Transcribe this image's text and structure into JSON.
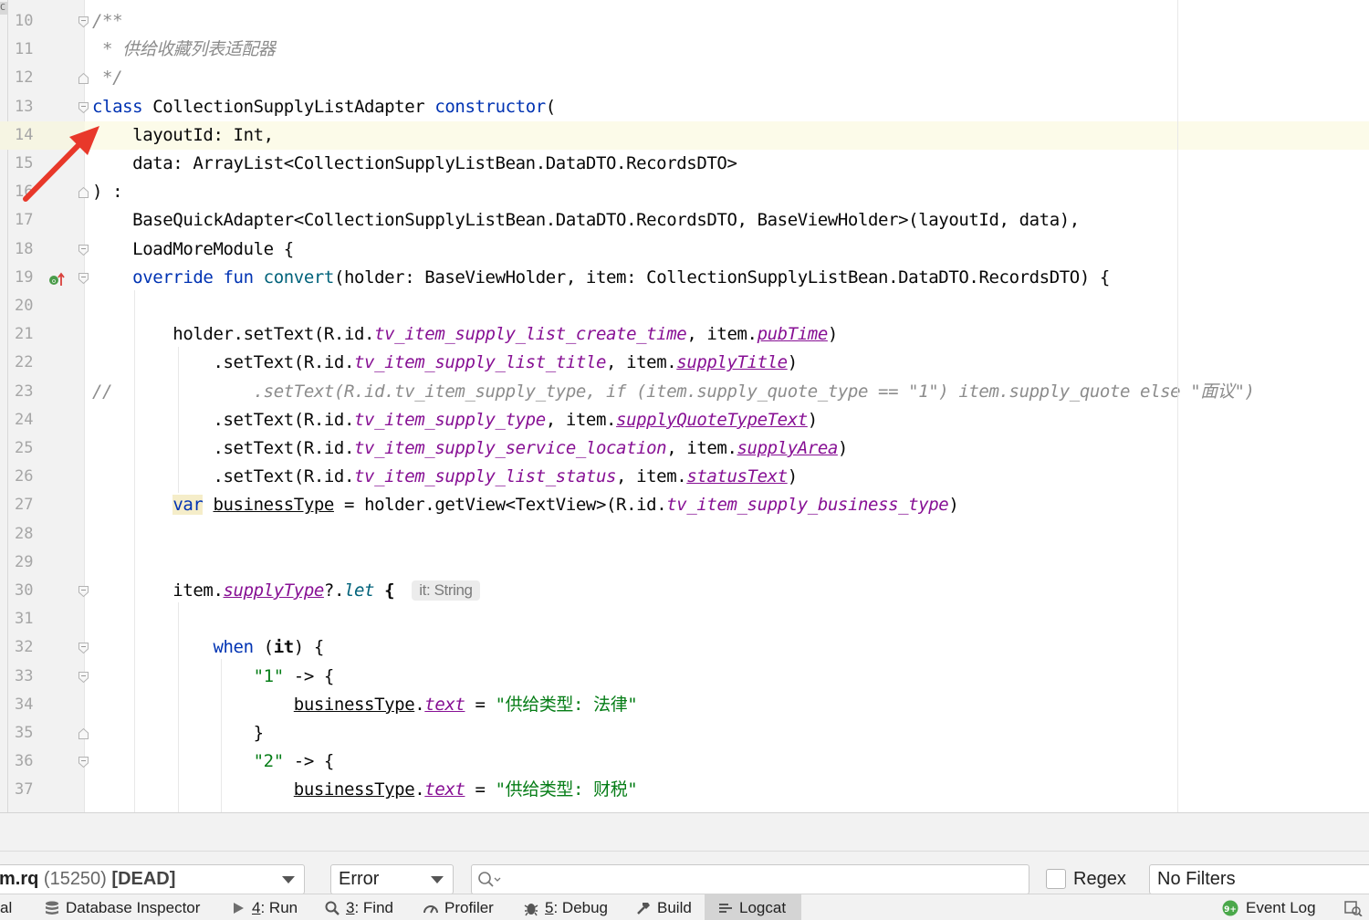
{
  "editor": {
    "lines": [
      {
        "n": "10",
        "code": "<span class=\"cm\">/**</span>"
      },
      {
        "n": "11",
        "code": "<span class=\"cm\"> * 供给收藏列表适配器</span>"
      },
      {
        "n": "12",
        "code": "<span class=\"cm\"> */</span>"
      },
      {
        "n": "13",
        "code": "<span class=\"kw\">class</span> CollectionSupplyListAdapter <span class=\"kw\">constructor</span>("
      },
      {
        "n": "14",
        "code": "    layoutId: Int,"
      },
      {
        "n": "15",
        "code": "    data: ArrayList&lt;CollectionSupplyListBean.DataDTO.RecordsDTO&gt;"
      },
      {
        "n": "16",
        "code": ") :"
      },
      {
        "n": "17",
        "code": "    BaseQuickAdapter&lt;CollectionSupplyListBean.DataDTO.RecordsDTO, BaseViewHolder&gt;(layoutId, data),"
      },
      {
        "n": "18",
        "code": "    LoadMoreModule {"
      },
      {
        "n": "19",
        "code": "    <span class=\"kw\">override fun</span> <span class=\"fn\">convert</span>(holder: BaseViewHolder, item: CollectionSupplyListBean.DataDTO.RecordsDTO) {"
      },
      {
        "n": "20",
        "code": ""
      },
      {
        "n": "21",
        "code": "        holder.setText(R.id.<span class=\"res\">tv_item_supply_list_create_time</span>, item.<span class=\"prop\">pubTime</span>)"
      },
      {
        "n": "22",
        "code": "            .setText(R.id.<span class=\"res\">tv_item_supply_list_title</span>, item.<span class=\"prop\">supplyTitle</span>)"
      },
      {
        "n": "23",
        "code": "<span class=\"cm\">//              .setText(R.id.tv_item_supply_type, if (item.supply_quote_type == \"1\") item.supply_quote else \"面议\")</span>"
      },
      {
        "n": "24",
        "code": "            .setText(R.id.<span class=\"res\">tv_item_supply_type</span>, item.<span class=\"prop\">supplyQuoteTypeText</span>)"
      },
      {
        "n": "25",
        "code": "            .setText(R.id.<span class=\"res\">tv_item_supply_service_location</span>, item.<span class=\"prop\">supplyArea</span>)"
      },
      {
        "n": "26",
        "code": "            .setText(R.id.<span class=\"res\">tv_item_supply_list_status</span>, item.<span class=\"prop\">statusText</span>)"
      },
      {
        "n": "27",
        "code": "        <span class=\"kw var-hl\">var</span> <span class=\"und\">businessType</span> = holder.getView&lt;TextView&gt;(R.id.<span class=\"res\">tv_item_supply_business_type</span>)"
      },
      {
        "n": "28",
        "code": ""
      },
      {
        "n": "29",
        "code": ""
      },
      {
        "n": "30",
        "code": "        item.<span class=\"prop\">supplyType</span>?.<span class=\"fn\" style=\"font-style:italic\">let</span> <b>{</b> <span class=\"hint\">it: String</span>"
      },
      {
        "n": "31",
        "code": ""
      },
      {
        "n": "32",
        "code": "            <span class=\"kw\">when</span> (<b>it</b>) {"
      },
      {
        "n": "33",
        "code": "                <span class=\"str\">\"1\"</span> -&gt; {"
      },
      {
        "n": "34",
        "code": "                    <span class=\"und\">businessType</span>.<span class=\"prop\">text</span> = <span class=\"str\">\"供给类型: 法律\"</span>"
      },
      {
        "n": "35",
        "code": "                }"
      },
      {
        "n": "36",
        "code": "                <span class=\"str\">\"2\"</span> -&gt; {"
      },
      {
        "n": "37",
        "code": "                    <span class=\"und\">businessType</span>.<span class=\"prop\">text</span> = <span class=\"str\">\"供给类型: 财税\"</span>"
      }
    ],
    "current_line": "14",
    "gutter_top_glyph": "C"
  },
  "logcat": {
    "device_name": "m.rq",
    "device_pid": "(15250)",
    "device_state": "[DEAD]",
    "level": "Error",
    "search_placeholder": "",
    "regex_label": "Regex",
    "filters": "No Filters"
  },
  "toolbar": {
    "left_cut": "al",
    "database_inspector": "Database Inspector",
    "run_num": "4",
    "run_label": ": Run",
    "find_num": "3",
    "find_label": ": Find",
    "profiler": "Profiler",
    "debug_num": "5",
    "debug_label": ": Debug",
    "build": "Build",
    "logcat": "Logcat",
    "event_log": "Event Log",
    "event_badge": "9+"
  },
  "colors": {
    "keyword": "#0033b3",
    "comment": "#8c8c8c",
    "resource": "#871094",
    "string": "#067d17",
    "arrow": "#e8382a"
  }
}
